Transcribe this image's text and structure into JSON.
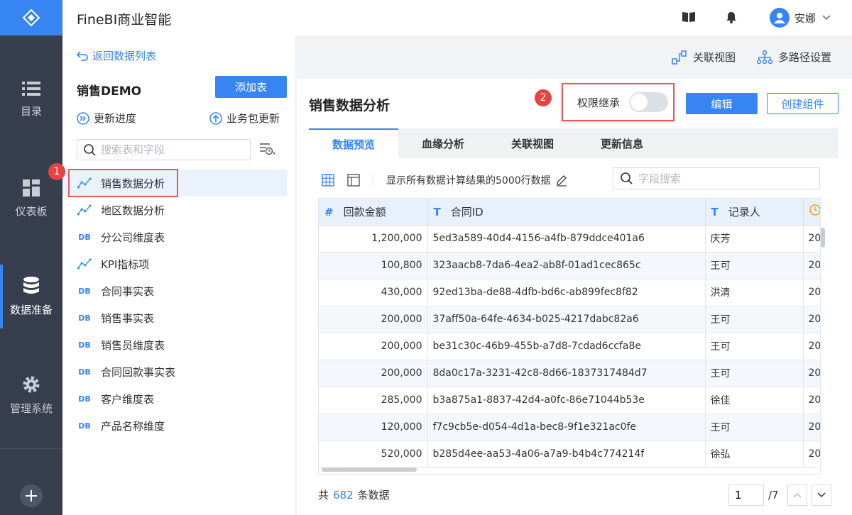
{
  "app_title": "FineBI商业智能",
  "nav": {
    "items": [
      {
        "label": "目录",
        "icon": "list-icon"
      },
      {
        "label": "仪表板",
        "icon": "dashboard-icon"
      },
      {
        "label": "数据准备",
        "icon": "database-icon"
      },
      {
        "label": "管理系统",
        "icon": "gear-icon"
      }
    ],
    "active": "数据准备"
  },
  "header": {
    "user_name": "安娜"
  },
  "sidebar": {
    "back_label": "返回数据列表",
    "package_title": "销售DEMO",
    "add_table_label": "添加表",
    "update_progress_label": "更新进度",
    "update_package_label": "业务包更新",
    "search_placeholder": "搜索表和字段",
    "items": [
      {
        "label": "销售数据分析",
        "type": "analysis"
      },
      {
        "label": "地区数据分析",
        "type": "analysis"
      },
      {
        "label": "分公司维度表",
        "type": "db"
      },
      {
        "label": "KPI指标项",
        "type": "analysis"
      },
      {
        "label": "合同事实表",
        "type": "db"
      },
      {
        "label": "销售事实表",
        "type": "db"
      },
      {
        "label": "销售员维度表",
        "type": "db"
      },
      {
        "label": "合同回款事实表",
        "type": "db"
      },
      {
        "label": "客户维度表",
        "type": "db"
      },
      {
        "label": "产品名称维度",
        "type": "db"
      }
    ],
    "db_icon_text": "DB"
  },
  "top_actions": {
    "relation_view": "关联视图",
    "multipath": "多路径设置"
  },
  "main": {
    "title": "销售数据分析",
    "perm_label": "权限继承",
    "perm_enabled": false,
    "edit_label": "编辑",
    "create_label": "创建组件",
    "tabs": [
      "数据预览",
      "血缘分析",
      "关联视图",
      "更新信息"
    ],
    "toolbar_text": "显示所有数据计算结果的5000行数据",
    "field_search_placeholder": "字段搜索",
    "columns": [
      {
        "type_icon": "#",
        "label": "回款金额"
      },
      {
        "type_icon": "T",
        "label": "合同ID"
      },
      {
        "type_icon": "T",
        "label": "记录人"
      }
    ],
    "rows": [
      [
        "1,200,000",
        "5ed3a589-40d4-4156-a4fb-879ddce401a6",
        "庆芳",
        "20"
      ],
      [
        "100,800",
        "323aacb8-7da6-4ea2-ab8f-01ad1cec865c",
        "王可",
        "20"
      ],
      [
        "430,000",
        "92ed13ba-de88-4dfb-bd6c-ab899fec8f82",
        "洪清",
        "20"
      ],
      [
        "200,000",
        "37aff50a-64fe-4634-b025-4217dabc82a6",
        "王可",
        "20"
      ],
      [
        "200,000",
        "be31c30c-46b9-455b-a7d8-7cdad6ccfa8e",
        "王可",
        "20"
      ],
      [
        "200,000",
        "8da0c17a-3231-42c8-8d66-1837317484d7",
        "王可",
        "20"
      ],
      [
        "285,000",
        "b3a875a1-8837-42d4-a0fc-86e71044b53e",
        "徐佳",
        "20"
      ],
      [
        "120,000",
        "f7c9cb5e-d054-4d1a-bec8-9f1e321ac0fe",
        "王可",
        "20"
      ],
      [
        "520,000",
        "b285d4ee-aa53-4a06-a7a9-b4b4c774214f",
        "徐弘",
        "20"
      ]
    ],
    "footer": {
      "prefix": "共",
      "count": "682",
      "suffix": "条数据"
    },
    "pager": {
      "page": "1",
      "total": "/7"
    }
  },
  "badges": [
    "1",
    "2"
  ],
  "colors": {
    "accent": "#3685f2",
    "nav_bg": "#373f4f",
    "highlight": "#e85a5a"
  }
}
